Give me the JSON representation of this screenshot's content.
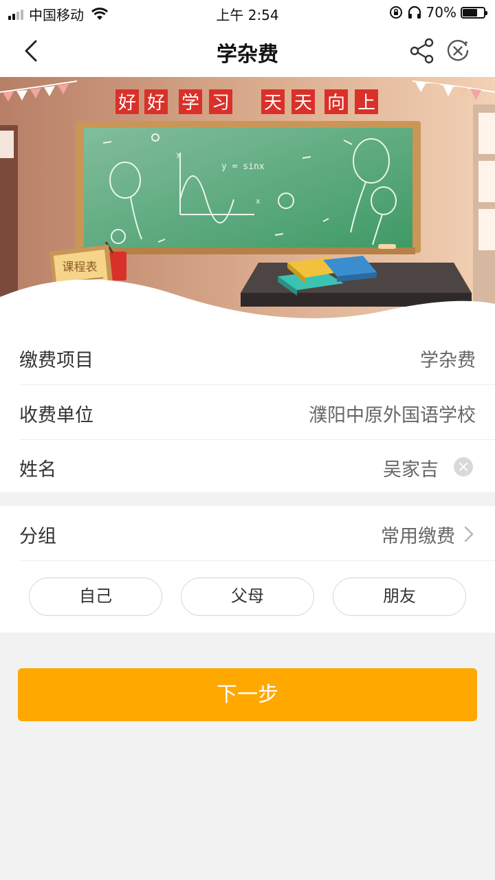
{
  "status_bar": {
    "carrier": "中国移动",
    "time": "上午 2:54",
    "battery_text": "70%",
    "battery_level": 0.7
  },
  "nav": {
    "title": "学杂费",
    "back_icon": "chevron-left-icon",
    "share_icon": "share-icon",
    "close_icon": "close-circle-icon"
  },
  "banner": {
    "slogan_left": [
      "好",
      "好",
      "学",
      "习"
    ],
    "slogan_right": [
      "天",
      "天",
      "向",
      "上"
    ],
    "chalk_formula": "y = sinx",
    "chalk_axis_y": "y",
    "chalk_axis_x": "x",
    "schedule_sign": "课程表"
  },
  "form": {
    "rows": [
      {
        "label": "缴费项目",
        "value": "学杂费"
      },
      {
        "label": "收费单位",
        "value": "濮阳中原外国语学校"
      },
      {
        "label": "姓名",
        "value": "吴家吉"
      }
    ]
  },
  "group": {
    "label": "分组",
    "value": "常用缴费",
    "chips": [
      "自己",
      "父母",
      "朋友"
    ]
  },
  "next_button": "下一步",
  "colors": {
    "accent": "#ffa800",
    "chalkboard": "#3f9a66",
    "slogan_red": "#d9312a"
  }
}
